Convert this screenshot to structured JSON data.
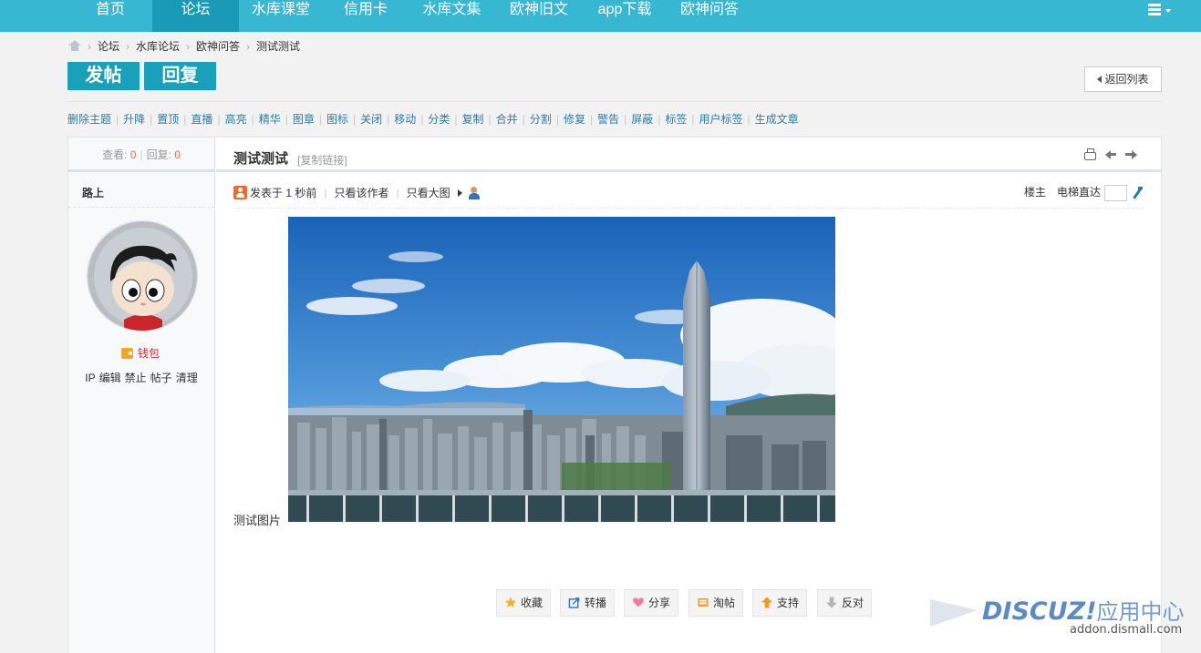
{
  "nav": {
    "items": [
      {
        "label": "首页"
      },
      {
        "label": "论坛",
        "active": true
      },
      {
        "label": "水库课堂"
      },
      {
        "label": "信用卡"
      },
      {
        "label": "水库文集"
      },
      {
        "label": "欧神旧文"
      },
      {
        "label": "app下载"
      },
      {
        "label": "欧神问答"
      }
    ],
    "menu_icon": "list-icon"
  },
  "breadcrumb": {
    "home_icon": "home-icon",
    "items": [
      "论坛",
      "水库论坛",
      "欧神问答",
      "测试测试"
    ]
  },
  "actions_top": {
    "post_label": "发帖",
    "reply_label": "回复",
    "back_label": "返回列表"
  },
  "modbar": {
    "items": [
      "删除主题",
      "升降",
      "置顶",
      "直播",
      "高亮",
      "精华",
      "图章",
      "图标",
      "关闭",
      "移动",
      "分类",
      "复制",
      "合并",
      "分割",
      "修复",
      "警告",
      "屏蔽",
      "标签",
      "用户标签",
      "生成文章"
    ]
  },
  "sidebar": {
    "views_label": "查看:",
    "views": "0",
    "replies_label": "回复:",
    "replies": "0",
    "author": "路上",
    "wallet_label": "钱包",
    "admin_links": [
      "IP",
      "编辑",
      "禁止",
      "帖子",
      "清理"
    ]
  },
  "thread": {
    "title": "测试测试",
    "copy_link": "[复制链接]",
    "posted": "发表于 1 秒前",
    "only_author": "只看该作者",
    "only_big_image": "只看大图",
    "floor_label": "楼主",
    "elevator_label": "电梯直达",
    "body_text": "测试图片"
  },
  "post_actions": [
    {
      "label": "收藏",
      "icon": "star-icon"
    },
    {
      "label": "转播",
      "icon": "share-arrow-icon"
    },
    {
      "label": "分享",
      "icon": "heart-icon"
    },
    {
      "label": "淘帖",
      "icon": "tray-icon"
    },
    {
      "label": "支持",
      "icon": "thumb-up-arrow-icon"
    },
    {
      "label": "反对",
      "icon": "thumb-down-arrow-icon"
    }
  ],
  "watermark": {
    "brand": "DISCUZ!",
    "cn": "应用中心",
    "url": "addon.dismall.com"
  },
  "colors": {
    "nav_bg": "#38b7d2",
    "nav_active": "#1a9ab6",
    "button_bg": "#19a0bb",
    "link": "#2b7ea6",
    "count": "#f26c4f"
  }
}
